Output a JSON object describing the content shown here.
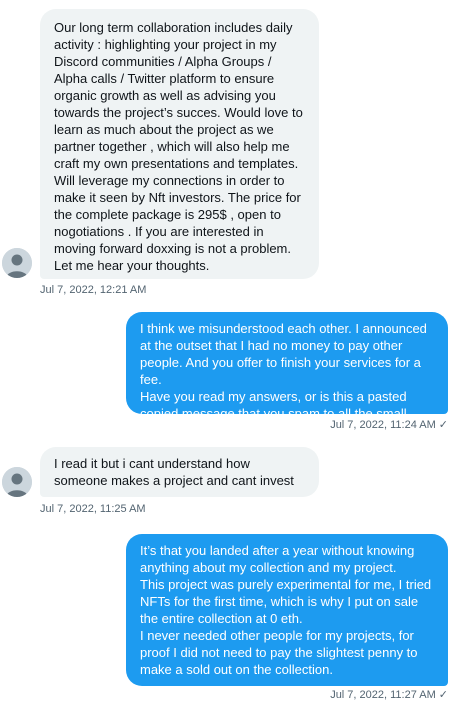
{
  "messages": [
    {
      "direction": "received",
      "text": "Our long term collaboration includes daily activity : highlighting your project in my Discord communities / Alpha Groups / Alpha calls / Twitter platform to ensure organic growth as well as advising you towards the project’s succes. Would love to learn as much about the project as we partner together , which will also help me craft my own presentations and templates. Will leverage my connections in order to make it seen by Nft investors. The price for the complete package is 295$ , open to nogotiations . If you are interested in moving forward doxxing is not a problem. Let me hear your thoughts.",
      "timestamp": "Jul 7, 2022, 12:21 AM"
    },
    {
      "direction": "sent",
      "text": "I think we misunderstood each other. I announced at the outset that I had no money to pay other people. And you offer to finish your services for a fee.\nHave you read my answers, or is this a pasted copied message that you spam to all the small collections?",
      "timestamp": "Jul 7, 2022, 11:24 AM",
      "status_icon": "checkmark-icon"
    },
    {
      "direction": "received",
      "text": "I read it but i cant understand how someone makes a project and cant invest",
      "timestamp": "Jul 7, 2022, 11:25 AM"
    },
    {
      "direction": "sent",
      "text": "It’s that you landed after a year without knowing anything about my collection and my project.\nThis project was purely experimental for me, I tried NFTs for the first time, which is why I put on sale the entire collection at 0 eth.\nI never needed other people for my projects, for proof I did not need to pay the slightest penny to make a sold out on the collection.",
      "timestamp": "Jul 7, 2022, 11:27 AM",
      "status_icon": "checkmark-icon"
    }
  ],
  "colors": {
    "sent_bubble": "#1d9bf0",
    "received_bubble": "#eff3f4",
    "meta_text": "#536471"
  }
}
